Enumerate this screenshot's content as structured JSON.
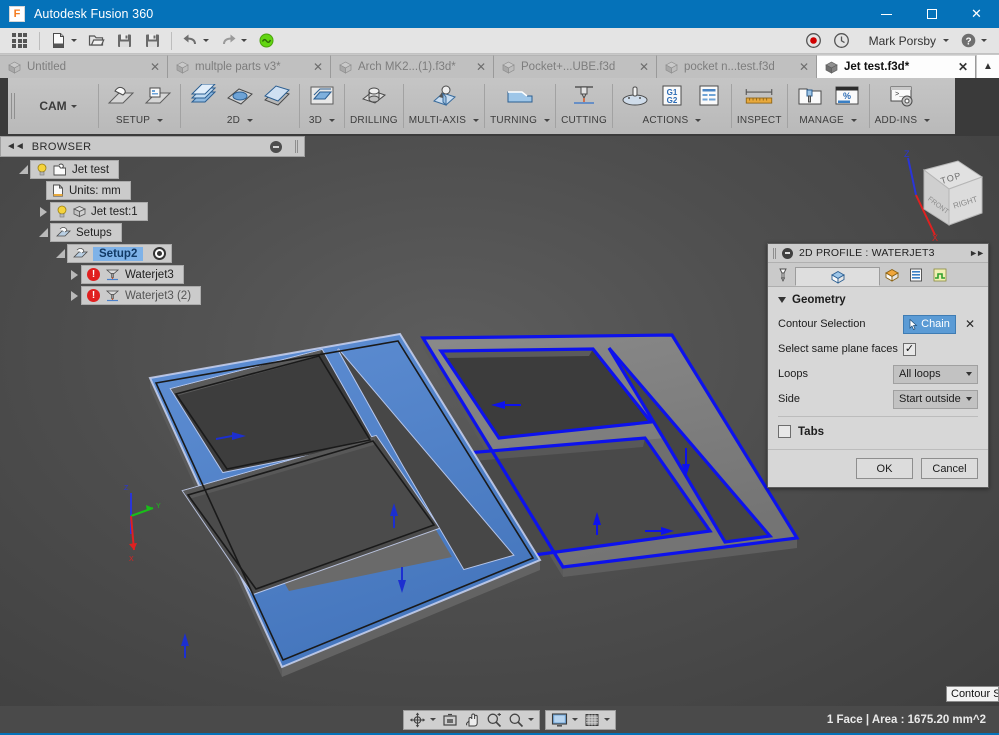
{
  "window": {
    "title": "Autodesk Fusion 360",
    "logo_letter": "F",
    "minimize_icon": "minimize-icon",
    "maximize_icon": "maximize-icon",
    "close_icon": "close-icon"
  },
  "quick_access": {
    "app_grid_icon": "app-grid-icon",
    "new_icon": "new-document-icon",
    "open_icon": "open-folder-icon",
    "save_icon": "save-icon",
    "save_as_icon": "save-as-icon",
    "undo_icon": "undo-icon",
    "redo_icon": "redo-icon",
    "status_icon": "job-status-icon",
    "record_icon": "record-icon",
    "recent_icon": "recent-clock-icon",
    "user_name": "Mark Porsby",
    "help_icon": "help-icon"
  },
  "document_tabs": [
    {
      "label": "Untitled",
      "active": false
    },
    {
      "label": "multple parts v3*",
      "active": false
    },
    {
      "label": "Arch MK2...(1).f3d*",
      "active": false
    },
    {
      "label": "Pocket+...UBE.f3d",
      "active": false
    },
    {
      "label": "pocket n...test.f3d",
      "active": false
    },
    {
      "label": "Jet test.f3d*",
      "active": true
    }
  ],
  "ribbon": {
    "workspace": "CAM",
    "groups": [
      {
        "label": "SETUP",
        "dropdown": true,
        "icons": [
          "setup-icon",
          "setup-folder-icon"
        ]
      },
      {
        "label": "2D",
        "dropdown": true,
        "icons": [
          "face-2d-icon",
          "pocket-2d-icon",
          "adaptive-2d-icon"
        ]
      },
      {
        "label": "3D",
        "dropdown": true,
        "icons": [
          "adaptive-3d-icon"
        ]
      },
      {
        "label": "DRILLING",
        "dropdown": false,
        "icons": [
          "drilling-icon"
        ]
      },
      {
        "label": "MULTI-AXIS",
        "dropdown": true,
        "icons": [
          "multiaxis-icon"
        ]
      },
      {
        "label": "TURNING",
        "dropdown": true,
        "icons": [
          "turning-icon"
        ]
      },
      {
        "label": "CUTTING",
        "dropdown": false,
        "icons": [
          "cutting-icon"
        ]
      },
      {
        "label": "ACTIONS",
        "dropdown": true,
        "icons": [
          "simulate-icon",
          "postprocess-g1g2-icon",
          "setup-sheet-icon"
        ]
      },
      {
        "label": "INSPECT",
        "dropdown": false,
        "icons": [
          "measure-ruler-icon"
        ]
      },
      {
        "label": "MANAGE",
        "dropdown": true,
        "icons": [
          "tool-library-icon",
          "machining-time-icon"
        ]
      },
      {
        "label": "ADD-INS",
        "dropdown": true,
        "icons": [
          "scripts-addins-icon"
        ]
      }
    ]
  },
  "browser": {
    "title": "BROWSER",
    "collapse_icon": "collapse-left-icon",
    "minimize_icon": "panel-minimize-icon",
    "tree": [
      {
        "label": "Jet test",
        "indent": 0,
        "expander": "open",
        "icons": [
          "light-bulb-icon",
          "document-root-icon"
        ]
      },
      {
        "label": "Units: mm",
        "indent": 1,
        "expander": "none",
        "icons": [
          "units-document-icon"
        ]
      },
      {
        "label": "Jet test:1",
        "indent": 1,
        "expander": "closed",
        "icons": [
          "light-bulb-icon",
          "body-cube-icon"
        ]
      },
      {
        "label": "Setups",
        "indent": 1,
        "expander": "open",
        "icons": [
          "setup-folder-icon"
        ]
      },
      {
        "label": "Setup2",
        "indent": 2,
        "expander": "open",
        "icons": [
          "setup-icon"
        ],
        "selected": true,
        "trailing_icon": "setup-target-icon"
      },
      {
        "label": "Waterjet3",
        "indent": 3,
        "expander": "closed",
        "icons": [
          "error-icon",
          "waterjet-toolpath-icon"
        ]
      },
      {
        "label": "Waterjet3 (2)",
        "indent": 3,
        "expander": "closed",
        "icons": [
          "error-icon",
          "waterjet-toolpath-icon"
        ],
        "dim": true
      }
    ]
  },
  "viewcube": {
    "top_face_label": "TOP",
    "front_face_label": "FRONT",
    "right_face_label": "RIGHT",
    "axis_x_label": "X",
    "axis_z_label": "Z"
  },
  "origin_triad": {
    "axis_x_label": "X",
    "axis_y_label": "Y",
    "axis_z_label": "Z"
  },
  "dialog": {
    "title": "2D PROFILE : WATERJET3",
    "minimize_icon": "dialog-minimize-icon",
    "expand_icon": "dialog-expand-icon",
    "tabs": [
      {
        "name": "tool-tab",
        "icon": "tool-icon",
        "selected": false
      },
      {
        "name": "geometry-tab",
        "icon": "geometry-icon",
        "selected": true
      },
      {
        "name": "heights-tab",
        "icon": "heights-icon",
        "selected": false
      },
      {
        "name": "passes-tab",
        "icon": "passes-icon",
        "selected": false
      },
      {
        "name": "linking-tab",
        "icon": "linking-icon",
        "selected": false
      }
    ],
    "section_title": "Geometry",
    "fields": {
      "contour_selection_label": "Contour Selection",
      "contour_selection_value": "Chain",
      "contour_clear_icon": "clear-selection-icon",
      "same_plane_label": "Select same plane faces",
      "same_plane_checked": true,
      "loops_label": "Loops",
      "loops_value": "All loops",
      "side_label": "Side",
      "side_value": "Start outside",
      "tabs_label": "Tabs",
      "tabs_checked": false
    },
    "ok_label": "OK",
    "cancel_label": "Cancel"
  },
  "tooltip": {
    "text": "Contour S"
  },
  "bottom_bar": {
    "nav_buttons": [
      {
        "name": "orbit-icon",
        "dropdown": true
      },
      {
        "name": "look-at-icon",
        "dropdown": false
      },
      {
        "name": "pan-hand-icon",
        "dropdown": false
      },
      {
        "name": "zoom-window-icon",
        "dropdown": false
      },
      {
        "name": "zoom-icon",
        "dropdown": true
      }
    ],
    "display_buttons": [
      {
        "name": "display-settings-icon",
        "dropdown": true
      },
      {
        "name": "grid-snap-icon",
        "dropdown": true
      }
    ],
    "status_text": "1 Face | Area : 1675.20 mm^2"
  },
  "colors": {
    "title_blue": "#0572b9",
    "selection_blue": "#4a7fc8",
    "toolpath_blue": "#0d12ec",
    "error_red": "#e01f1f",
    "viewport_gray": "#4e4e4e",
    "part_gray": "#7f7f7f"
  }
}
